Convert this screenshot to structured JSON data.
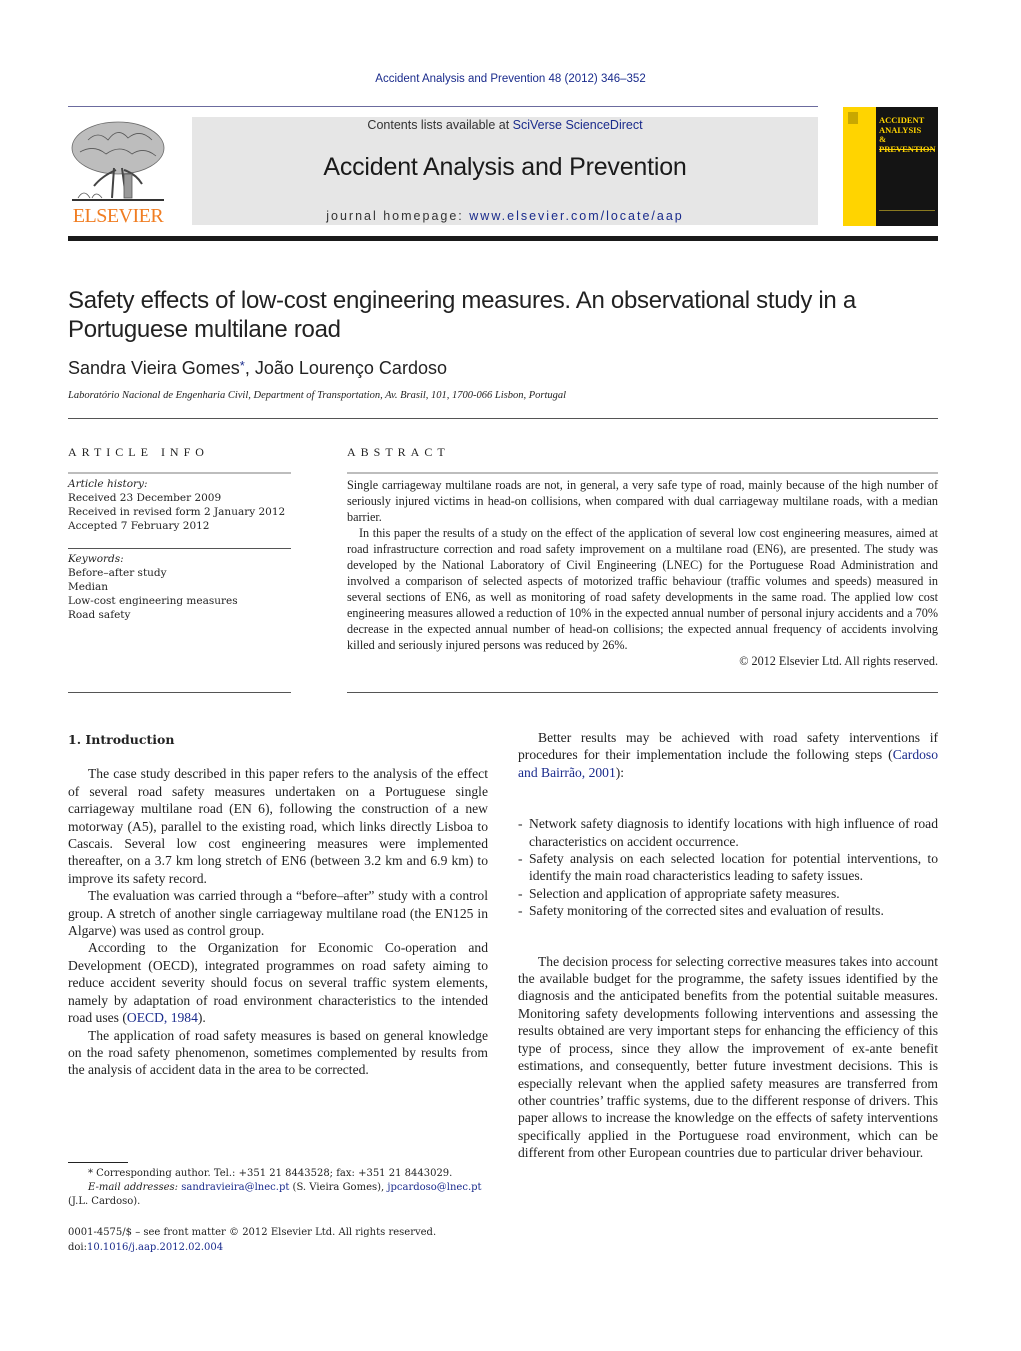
{
  "citation": "Accident Analysis and Prevention 48 (2012) 346–352",
  "header": {
    "publisher_logo_text": "ELSEVIER",
    "contents_prefix": "Contents lists available at ",
    "contents_link": "SciVerse ScienceDirect",
    "journal_title": "Accident Analysis and Prevention",
    "homepage_prefix": "journal homepage: ",
    "homepage_link": "www.elsevier.com/locate/aap",
    "cover_title_lines": [
      "ACCIDENT",
      "ANALYSIS",
      "&",
      "PREVENTION"
    ]
  },
  "colors": {
    "link": "#1a2b8c",
    "elsevier_orange": "#f07d22",
    "cover_yellow": "#ffd400",
    "header_box_gray": "#e6e6e6"
  },
  "article": {
    "title": "Safety effects of low-cost engineering measures. An observational study in a Portuguese multilane road",
    "authors": [
      {
        "name": "Sandra Vieira Gomes",
        "mark": "*"
      },
      {
        "name": "João Lourenço Cardoso",
        "mark": ""
      }
    ],
    "author_separator": ", ",
    "affiliation": "Laboratório Nacional de Engenharia Civil, Department of Transportation, Av. Brasil, 101, 1700-066 Lisbon, Portugal"
  },
  "article_info": {
    "label": "ARTICLE INFO",
    "history_label": "Article history:",
    "history": [
      "Received 23 December 2009",
      "Received in revised form 2 January 2012",
      "Accepted 7 February 2012"
    ],
    "keywords_label": "Keywords:",
    "keywords": [
      "Before–after study",
      "Median",
      "Low-cost engineering measures",
      "Road safety"
    ]
  },
  "abstract": {
    "label": "ABSTRACT",
    "paragraphs": [
      "Single carriageway multilane roads are not, in general, a very safe type of road, mainly because of the high number of seriously injured victims in head-on collisions, when compared with dual carriageway multilane roads, with a median barrier.",
      "In this paper the results of a study on the effect of the application of several low cost engineering measures, aimed at road infrastructure correction and road safety improvement on a multilane road (EN6), are presented. The study was developed by the National Laboratory of Civil Engineering (LNEC) for the Portuguese Road Administration and involved a comparison of selected aspects of motorized traffic behaviour (traffic volumes and speeds) measured in several sections of EN6, as well as monitoring of road safety developments in the same road. The applied low cost engineering measures allowed a reduction of 10% in the expected annual number of personal injury accidents and a 70% decrease in the expected annual number of head-on collisions; the expected annual frequency of accidents involving killed and seriously injured persons was reduced by 26%."
    ],
    "copyright": "© 2012 Elsevier Ltd. All rights reserved."
  },
  "body": {
    "section_heading": "1.  Introduction",
    "left_paragraphs": [
      "The case study described in this paper refers to the analysis of the effect of several road safety measures undertaken on a Portuguese single carriageway multilane road (EN 6), following the construction of a new motorway (A5), parallel to the existing road, which links directly Lisboa to Cascais. Several low cost engineering measures were implemented thereafter, on a 3.7 km long stretch of EN6 (between 3.2 km and 6.9 km) to improve its safety record.",
      "The evaluation was carried through a “before–after” study with a control group. A stretch of another single carriageway multilane road (the EN125 in Algarve) was used as control group."
    ],
    "oecd_paragraph": {
      "before": "According to the Organization for Economic Co-operation and Development (OECD), integrated programmes on road safety aiming to reduce accident severity should focus on several traffic system elements, namely by adaptation of road environment characteristics to the intended road uses (",
      "link": "OECD, 1984",
      "after": ")."
    },
    "left_last_paragraph": "The application of road safety measures is based on general knowledge on the road safety phenomenon, sometimes complemented by results from the analysis of accident data in the area to be corrected.",
    "right_intro": {
      "before": "Better results may be achieved with road safety interventions if procedures for their implementation include the following steps (",
      "link": "Cardoso and Bairrão, 2001",
      "after": "):"
    },
    "steps": [
      "Network safety diagnosis to identify locations with high influence of road characteristics on accident occurrence.",
      "Safety analysis on each selected location for potential interventions, to identify the main road characteristics leading to safety issues.",
      "Selection and application of appropriate safety measures.",
      "Safety monitoring of the corrected sites and evaluation of results."
    ],
    "step_marker": "-",
    "right_last_paragraph": "The decision process for selecting corrective measures takes into account the available budget for the programme, the safety issues identified by the diagnosis and the anticipated benefits from the potential suitable measures. Monitoring safety developments following interventions and assessing the results obtained are very important steps for enhancing the efficiency of this type of process, since they allow the improvement of ex-ante benefit estimations, and consequently, better future investment decisions. This is especially relevant when the applied safety measures are transferred from other countries’ traffic systems, due to the different response of drivers. This paper allows to increase the knowledge on the effects of safety interventions specifically applied in the Portuguese road environment, which can be different from other European countries due to particular driver behaviour."
  },
  "footnote": {
    "mark": "*",
    "corresponding": " Corresponding author. Tel.: +351 21 8443528; fax: +351 21 8443029.",
    "email_label": "E-mail addresses:",
    "email1": "sandravieira@lnec.pt",
    "email1_owner": " (S. Vieira Gomes), ",
    "email2": "jpcardoso@lnec.pt",
    "email2_owner": "(J.L. Cardoso)."
  },
  "front_matter": {
    "issn_line": "0001-4575/$ – see front matter © 2012 Elsevier Ltd. All rights reserved.",
    "doi_prefix": "doi:",
    "doi": "10.1016/j.aap.2012.02.004"
  }
}
